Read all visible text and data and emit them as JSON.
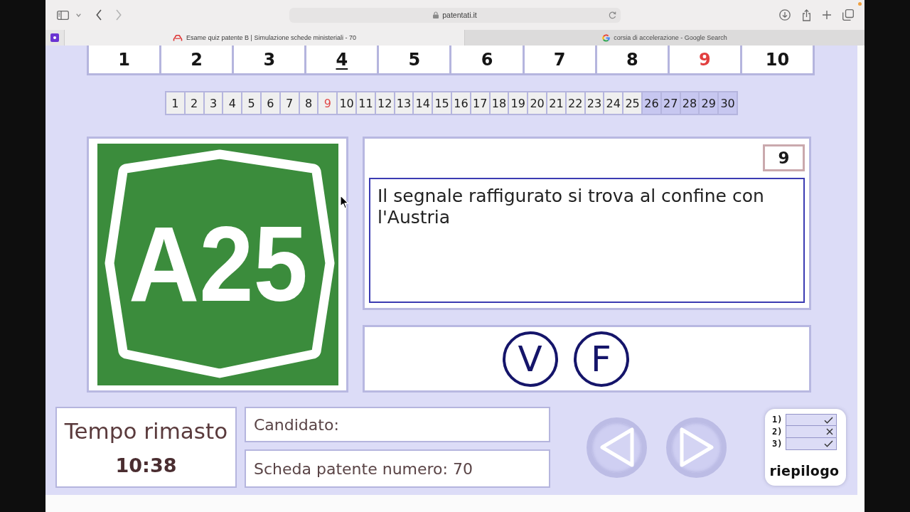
{
  "browser": {
    "address": "patentati.it",
    "tabs": [
      {
        "title": "Esame quiz patente B | Simulazione schede ministeriali - 70",
        "selected": true
      },
      {
        "title": "corsia di accelerazione - Google Search",
        "selected": false
      }
    ]
  },
  "question_groups": [
    {
      "label": "1",
      "selected": false,
      "underlined": false
    },
    {
      "label": "2",
      "selected": false,
      "underlined": false
    },
    {
      "label": "3",
      "selected": false,
      "underlined": false
    },
    {
      "label": "4",
      "selected": false,
      "underlined": true
    },
    {
      "label": "5",
      "selected": false,
      "underlined": false
    },
    {
      "label": "6",
      "selected": false,
      "underlined": false
    },
    {
      "label": "7",
      "selected": false,
      "underlined": false
    },
    {
      "label": "8",
      "selected": false,
      "underlined": false
    },
    {
      "label": "9",
      "selected": true,
      "underlined": false
    },
    {
      "label": "10",
      "selected": false,
      "underlined": false
    }
  ],
  "question_numbers": [
    {
      "label": "1",
      "selected": false,
      "highlighted": false
    },
    {
      "label": "2",
      "selected": false,
      "highlighted": false
    },
    {
      "label": "3",
      "selected": false,
      "highlighted": false
    },
    {
      "label": "4",
      "selected": false,
      "highlighted": false
    },
    {
      "label": "5",
      "selected": false,
      "highlighted": false
    },
    {
      "label": "6",
      "selected": false,
      "highlighted": false
    },
    {
      "label": "7",
      "selected": false,
      "highlighted": false
    },
    {
      "label": "8",
      "selected": false,
      "highlighted": false
    },
    {
      "label": "9",
      "selected": true,
      "highlighted": false
    },
    {
      "label": "10",
      "selected": false,
      "highlighted": false
    },
    {
      "label": "11",
      "selected": false,
      "highlighted": false
    },
    {
      "label": "12",
      "selected": false,
      "highlighted": false
    },
    {
      "label": "13",
      "selected": false,
      "highlighted": false
    },
    {
      "label": "14",
      "selected": false,
      "highlighted": false
    },
    {
      "label": "15",
      "selected": false,
      "highlighted": false
    },
    {
      "label": "16",
      "selected": false,
      "highlighted": false
    },
    {
      "label": "17",
      "selected": false,
      "highlighted": false
    },
    {
      "label": "18",
      "selected": false,
      "highlighted": false
    },
    {
      "label": "19",
      "selected": false,
      "highlighted": false
    },
    {
      "label": "20",
      "selected": false,
      "highlighted": false
    },
    {
      "label": "21",
      "selected": false,
      "highlighted": false
    },
    {
      "label": "22",
      "selected": false,
      "highlighted": false
    },
    {
      "label": "23",
      "selected": false,
      "highlighted": false
    },
    {
      "label": "24",
      "selected": false,
      "highlighted": false
    },
    {
      "label": "25",
      "selected": false,
      "highlighted": false
    },
    {
      "label": "26",
      "selected": false,
      "highlighted": true
    },
    {
      "label": "27",
      "selected": false,
      "highlighted": true
    },
    {
      "label": "28",
      "selected": false,
      "highlighted": true
    },
    {
      "label": "29",
      "selected": false,
      "highlighted": true
    },
    {
      "label": "30",
      "selected": false,
      "highlighted": true
    }
  ],
  "sign": {
    "text": "A25"
  },
  "question": {
    "number": "9",
    "text": "Il segnale raffigurato si trova al confine con l'Austria"
  },
  "answers": [
    "V",
    "F"
  ],
  "timer": {
    "label": "Tempo rimasto",
    "value": "10:38"
  },
  "candidate": {
    "label": "Candidato:"
  },
  "sheet": {
    "label": "Scheda patente numero: 70"
  },
  "summary_button": {
    "label": "riepilogo",
    "rows": [
      {
        "number": "1)",
        "kind": "check"
      },
      {
        "number": "2)",
        "kind": "cross"
      },
      {
        "number": "3)",
        "kind": "check"
      }
    ]
  }
}
